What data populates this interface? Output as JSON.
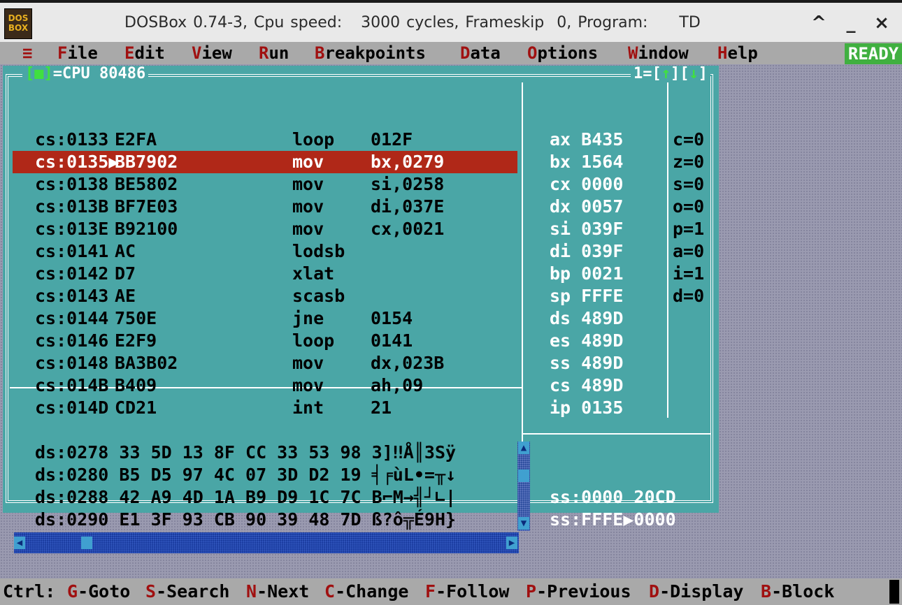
{
  "window": {
    "title": "DOSBox 0.74-3, Cpu speed:   3000 cycles, Frameskip  0, Program:     TD",
    "icon_text": "DOS BOX",
    "buttons": [
      "^",
      "_",
      "×"
    ]
  },
  "menu": {
    "items": [
      {
        "hot": "F",
        "rest": "ile"
      },
      {
        "hot": "E",
        "rest": "dit"
      },
      {
        "hot": "V",
        "rest": "iew"
      },
      {
        "hot": "R",
        "rest": "un"
      },
      {
        "hot": "B",
        "rest": "reakpoints"
      },
      {
        "hot": "D",
        "rest": "ata"
      },
      {
        "hot": "O",
        "rest": "ptions"
      },
      {
        "hot": "W",
        "rest": "indow"
      },
      {
        "hot": "H",
        "rest": "elp"
      }
    ],
    "hamburger": "≡",
    "status": "READY"
  },
  "cpu_window": {
    "title": "CPU 80486",
    "close_box": "[■]",
    "pane_indicator": "1=[",
    "up_arrow": "↑",
    "down_arrow": "↓",
    "disasm": [
      {
        "addr": "cs:0133",
        "bytes": "E2FA",
        "mnem": "loop",
        "ops": "012F",
        "selected": false
      },
      {
        "addr": "cs:0135▶",
        "bytes": "BB7902",
        "mnem": "mov",
        "ops": "bx,0279",
        "selected": true
      },
      {
        "addr": "cs:0138",
        "bytes": "BE5802",
        "mnem": "mov",
        "ops": "si,0258",
        "selected": false
      },
      {
        "addr": "cs:013B",
        "bytes": "BF7E03",
        "mnem": "mov",
        "ops": "di,037E",
        "selected": false
      },
      {
        "addr": "cs:013E",
        "bytes": "B92100",
        "mnem": "mov",
        "ops": "cx,0021",
        "selected": false
      },
      {
        "addr": "cs:0141",
        "bytes": "AC",
        "mnem": "lodsb",
        "ops": "",
        "selected": false
      },
      {
        "addr": "cs:0142",
        "bytes": "D7",
        "mnem": "xlat",
        "ops": "",
        "selected": false
      },
      {
        "addr": "cs:0143",
        "bytes": "AE",
        "mnem": "scasb",
        "ops": "",
        "selected": false
      },
      {
        "addr": "cs:0144",
        "bytes": "750E",
        "mnem": "jne",
        "ops": "0154",
        "selected": false
      },
      {
        "addr": "cs:0146",
        "bytes": "E2F9",
        "mnem": "loop",
        "ops": "0141",
        "selected": false
      },
      {
        "addr": "cs:0148",
        "bytes": "BA3B02",
        "mnem": "mov",
        "ops": "dx,023B",
        "selected": false
      },
      {
        "addr": "cs:014B",
        "bytes": "B409",
        "mnem": "mov",
        "ops": "ah,09",
        "selected": false
      },
      {
        "addr": "cs:014D",
        "bytes": "CD21",
        "mnem": "int",
        "ops": "21",
        "selected": false
      }
    ],
    "registers": [
      {
        "name": "ax",
        "value": "B435"
      },
      {
        "name": "bx",
        "value": "1564"
      },
      {
        "name": "cx",
        "value": "0000"
      },
      {
        "name": "dx",
        "value": "0057"
      },
      {
        "name": "si",
        "value": "039F"
      },
      {
        "name": "di",
        "value": "039F"
      },
      {
        "name": "bp",
        "value": "0021"
      },
      {
        "name": "sp",
        "value": "FFFE"
      },
      {
        "name": "ds",
        "value": "489D"
      },
      {
        "name": "es",
        "value": "489D"
      },
      {
        "name": "ss",
        "value": "489D"
      },
      {
        "name": "cs",
        "value": "489D"
      },
      {
        "name": "ip",
        "value": "0135"
      }
    ],
    "flags": [
      "c=0",
      "z=0",
      "s=0",
      "o=0",
      "p=1",
      "a=0",
      "i=1",
      "d=0"
    ],
    "dump": [
      "ds:0278 33 5D 13 8F CC 33 53 98 3]‼Å║​3Sÿ",
      "ds:0280 B5 D5 97 4C 07 3D D2 19 ╡╒ùL•=╥↓",
      "ds:0288 42 A9 4D 1A B9 D9 1C 7C B⌐M→╣┘∟|",
      "ds:0290 E1 3F 93 CB 90 39 48 7D ß?ô╦É9H}"
    ],
    "stack": [
      "ss:0000 20CD",
      "ss:FFFE▶0000"
    ]
  },
  "statusbar": {
    "prefix": "Ctrl:",
    "items": [
      {
        "key": "G",
        "label": "-Goto"
      },
      {
        "key": "S",
        "label": "-Search"
      },
      {
        "key": "N",
        "label": "-Next"
      },
      {
        "key": "C",
        "label": "-Change"
      },
      {
        "key": "F",
        "label": "-Follow"
      },
      {
        "key": "P",
        "label": "-Previous"
      },
      {
        "key": "D",
        "label": "-Display"
      },
      {
        "key": "B",
        "label": "-Block"
      }
    ]
  },
  "colors": {
    "window_bg": "#4aa6a6",
    "selected_row": "#b02818",
    "hotkey": "#a01010",
    "ready": "#40b040"
  }
}
